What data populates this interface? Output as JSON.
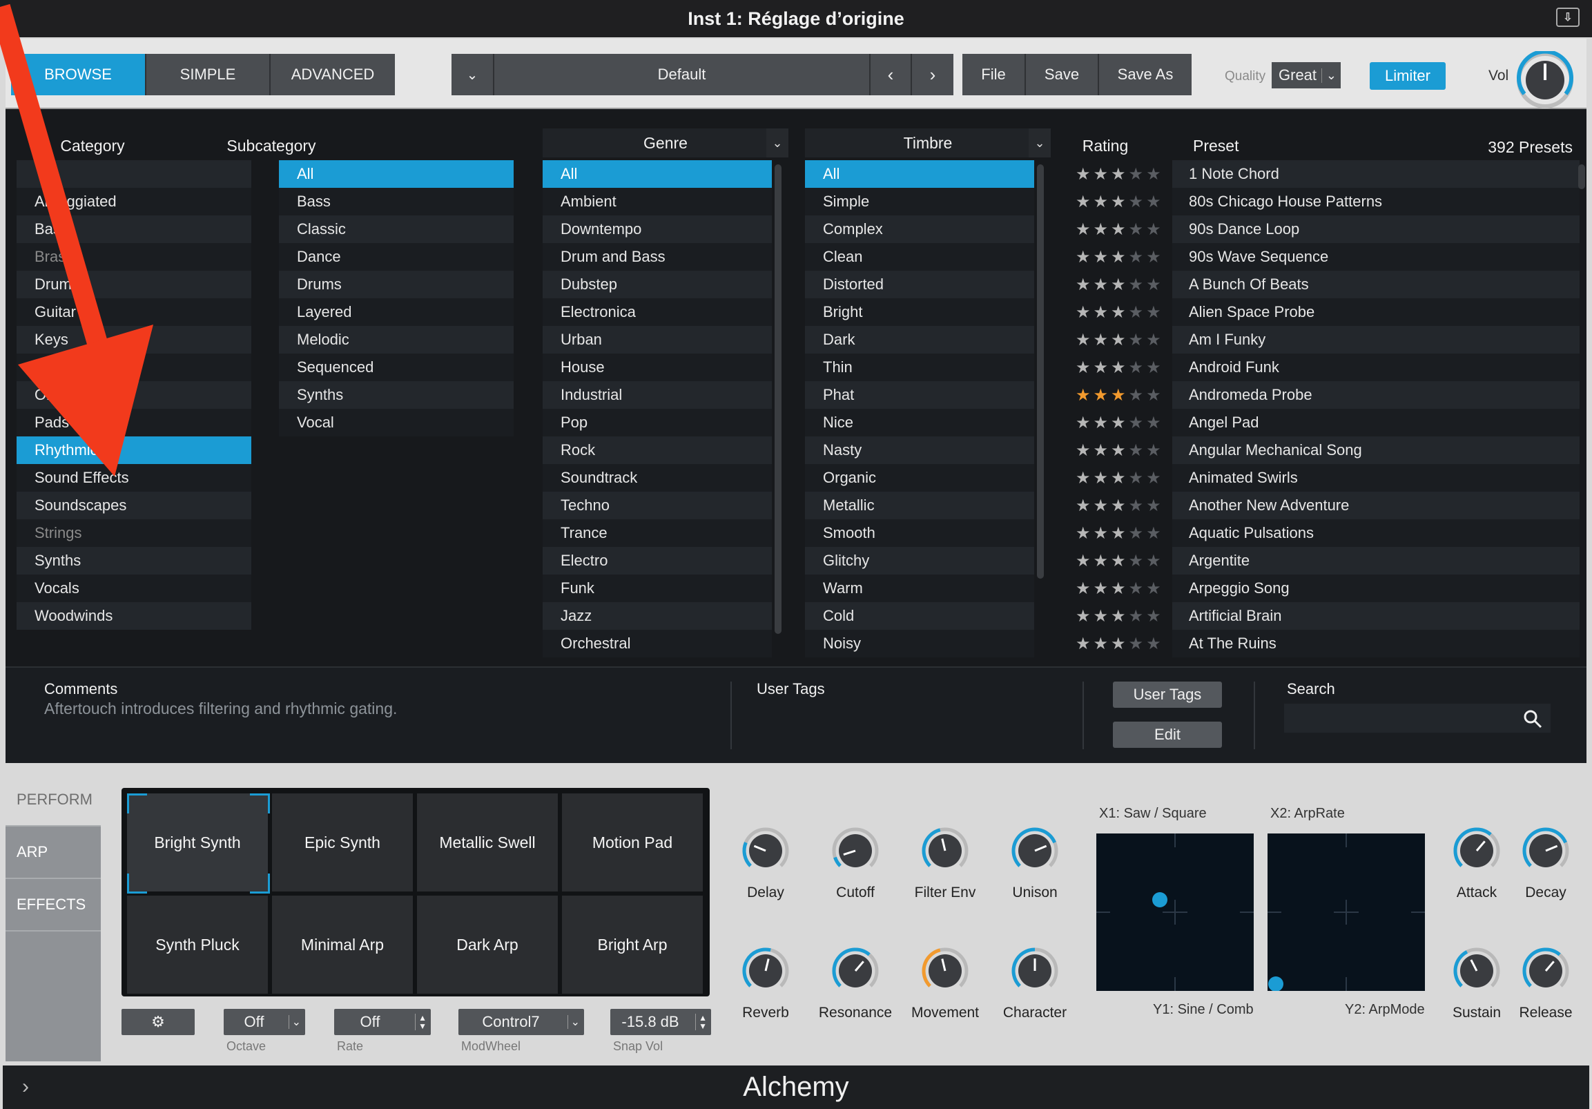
{
  "window_title": "Inst 1: Réglage d’origine",
  "toolbar": {
    "tabs": [
      "BROWSE",
      "SIMPLE",
      "ADVANCED"
    ],
    "preset_name": "Default",
    "file": "File",
    "save": "Save",
    "save_as": "Save As",
    "quality_label": "Quality",
    "quality_value": "Great",
    "limiter": "Limiter",
    "vol": "Vol"
  },
  "browser": {
    "headers": {
      "category": "Category",
      "subcategory": "Subcategory",
      "genre": "Genre",
      "timbre": "Timbre",
      "rating": "Rating",
      "preset": "Preset",
      "count": "392 Presets"
    },
    "category": [
      "",
      "Arpeggiated",
      "Bass",
      "Brass",
      "Drums",
      "Guitar",
      "Keys",
      "Mallets",
      "Organ",
      "Pads",
      "Rhythmic",
      "Sound Effects",
      "Soundscapes",
      "Strings",
      "Synths",
      "Vocals",
      "Woodwinds"
    ],
    "category_selected": "Rhythmic",
    "subcategory": [
      "All",
      "Bass",
      "Classic",
      "Dance",
      "Drums",
      "Layered",
      "Melodic",
      "Sequenced",
      "Synths",
      "Vocal"
    ],
    "genre": [
      "All",
      "Ambient",
      "Downtempo",
      "Drum and Bass",
      "Dubstep",
      "Electronica",
      "Urban",
      "House",
      "Industrial",
      "Pop",
      "Rock",
      "Soundtrack",
      "Techno",
      "Trance",
      "Electro",
      "Funk",
      "Jazz",
      "Orchestral"
    ],
    "timbre": [
      "All",
      "Simple",
      "Complex",
      "Clean",
      "Distorted",
      "Bright",
      "Dark",
      "Thin",
      "Phat",
      "Nice",
      "Nasty",
      "Organic",
      "Metallic",
      "Smooth",
      "Glitchy",
      "Warm",
      "Cold",
      "Noisy"
    ],
    "presets": [
      {
        "name": "1 Note Chord",
        "rating": 3
      },
      {
        "name": "80s Chicago House Patterns",
        "rating": 3
      },
      {
        "name": "90s Dance Loop",
        "rating": 3
      },
      {
        "name": "90s Wave Sequence",
        "rating": 3
      },
      {
        "name": "A Bunch Of Beats",
        "rating": 3
      },
      {
        "name": "Alien Space Probe",
        "rating": 3
      },
      {
        "name": "Am I Funky",
        "rating": 3
      },
      {
        "name": "Android Funk",
        "rating": 3
      },
      {
        "name": "Andromeda Probe",
        "rating": 3,
        "highlight": true
      },
      {
        "name": "Angel Pad",
        "rating": 3
      },
      {
        "name": "Angular Mechanical Song",
        "rating": 3
      },
      {
        "name": "Animated Swirls",
        "rating": 3
      },
      {
        "name": "Another New Adventure",
        "rating": 3
      },
      {
        "name": "Aquatic Pulsations",
        "rating": 3
      },
      {
        "name": "Argentite",
        "rating": 3
      },
      {
        "name": "Arpeggio Song",
        "rating": 3
      },
      {
        "name": "Artificial Brain",
        "rating": 3
      },
      {
        "name": "At The Ruins",
        "rating": 3
      }
    ]
  },
  "info": {
    "comments_label": "Comments",
    "comments_text": "Aftertouch introduces filtering and rhythmic gating.",
    "user_tags_label": "User Tags",
    "user_tags_btn": "User Tags",
    "edit_btn": "Edit",
    "search_label": "Search",
    "search_placeholder": ""
  },
  "perform": {
    "side_tabs": [
      "PERFORM",
      "ARP",
      "EFFECTS"
    ],
    "pads": [
      "Bright Synth",
      "Epic Synth",
      "Metallic Swell",
      "Motion Pad",
      "Synth Pluck",
      "Minimal Arp",
      "Dark Arp",
      "Bright Arp"
    ],
    "octave": "Off",
    "octave_label": "Octave",
    "rate": "Off",
    "rate_label": "Rate",
    "modwheel": "Control7",
    "modwheel_label": "ModWheel",
    "snapvol": "-15.8 dB",
    "snapvol_label": "Snap Vol",
    "knobs": [
      {
        "label": "Delay",
        "value": 0.25
      },
      {
        "label": "Cutoff",
        "value": 0.1
      },
      {
        "label": "Filter Env",
        "value": 0.45
      },
      {
        "label": "Unison",
        "value": 0.75
      },
      {
        "label": "Reverb",
        "value": 0.55
      },
      {
        "label": "Resonance",
        "value": 0.65
      },
      {
        "label": "Movement",
        "value": 0.45,
        "orange": true
      },
      {
        "label": "Character",
        "value": 0.5
      }
    ],
    "xy": {
      "x1": "X1: Saw / Square",
      "x2": "X2: ArpRate",
      "y1": "Y1: Sine / Comb",
      "y2": "Y2: ArpMode"
    },
    "env": [
      {
        "label": "Attack",
        "value": 0.65
      },
      {
        "label": "Decay",
        "value": 0.75
      },
      {
        "label": "Sustain",
        "value": 0.4
      },
      {
        "label": "Release",
        "value": 0.65
      }
    ]
  },
  "footer": {
    "title": "Alchemy"
  },
  "colors": {
    "accent": "#1b9cd4",
    "star_on": "#f29a2e",
    "arrow": "#f23a1c"
  }
}
